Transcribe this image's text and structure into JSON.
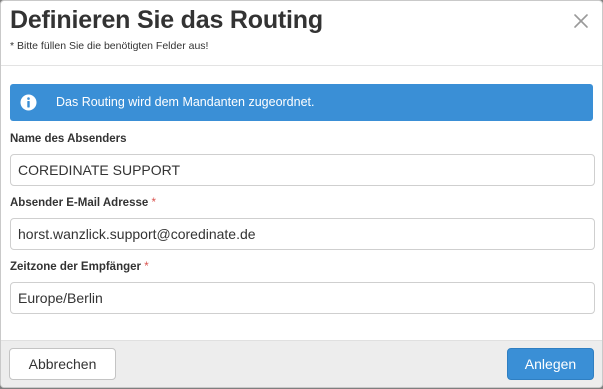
{
  "dialog": {
    "title": "Definieren Sie das Routing",
    "subtitle": "* Bitte füllen Sie die benötigten Felder aus!",
    "close_icon": "close-icon"
  },
  "info": {
    "icon": "info-icon",
    "text": "Das Routing wird dem Mandanten zugeordnet.",
    "color": "#3a8fd6"
  },
  "fields": {
    "sender_name": {
      "label": "Name des Absenders",
      "required": false,
      "value": "COREDINATE SUPPORT"
    },
    "sender_email": {
      "label": "Absender E-Mail Adresse",
      "required_mark": "*",
      "value": "horst.wanzlick.support@coredinate.de"
    },
    "timezone": {
      "label": "Zeitzone der Empfänger",
      "required_mark": "*",
      "value": "Europe/Berlin"
    }
  },
  "footer": {
    "cancel_label": "Abbrechen",
    "submit_label": "Anlegen",
    "primary_color": "#3a8fd6"
  }
}
